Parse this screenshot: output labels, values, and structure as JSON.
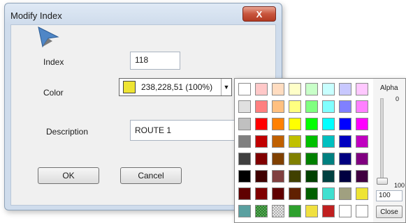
{
  "dialog": {
    "title": "Modify Index",
    "close_glyph": "X",
    "index_label": "Index",
    "index_value": "118",
    "color_label": "Color",
    "color_value": "238,228,51 (100%)",
    "color_hex": "#eee433",
    "description_label": "Description",
    "description_value": "ROUTE 1",
    "ok_label": "OK",
    "cancel_label": "Cancel"
  },
  "palette": {
    "alpha_label": "Alpha",
    "alpha_max": "0",
    "alpha_min": "100",
    "alpha_value": "100",
    "close_label": "Close",
    "rows": [
      [
        "#ffffff",
        "#ffc8c8",
        "#ffdcc0",
        "#ffffc8",
        "#c8ffc8",
        "#c8ffff",
        "#c8c8ff",
        "#ffc8ff"
      ],
      [
        "#e0e0e0",
        "#ff8080",
        "#ffc080",
        "#ffff80",
        "#80ff80",
        "#80ffff",
        "#8080ff",
        "#ff80ff"
      ],
      [
        "#c0c0c0",
        "#ff0000",
        "#ff8000",
        "#ffff00",
        "#00ff00",
        "#00ffff",
        "#0000ff",
        "#ff00ff"
      ],
      [
        "#808080",
        "#c00000",
        "#c06000",
        "#c0c000",
        "#00c000",
        "#00c0c0",
        "#0000c0",
        "#c000c0"
      ],
      [
        "#404040",
        "#800000",
        "#804000",
        "#808000",
        "#008000",
        "#008080",
        "#000080",
        "#800080"
      ],
      [
        "#000000",
        "#400000",
        "#804040",
        "#404000",
        "#004000",
        "#004040",
        "#000040",
        "#400040"
      ],
      [
        "#600000",
        "#800000",
        "#600000",
        "#602000",
        "#006000",
        "#40e0d0",
        "#a0a080",
        "#eee433"
      ],
      [
        "#5aa0a0",
        "pattern-a",
        "pattern-b",
        "#2ea02e",
        "#f0e040",
        "#c02020",
        "#ffffff",
        "#ffffff"
      ]
    ]
  }
}
